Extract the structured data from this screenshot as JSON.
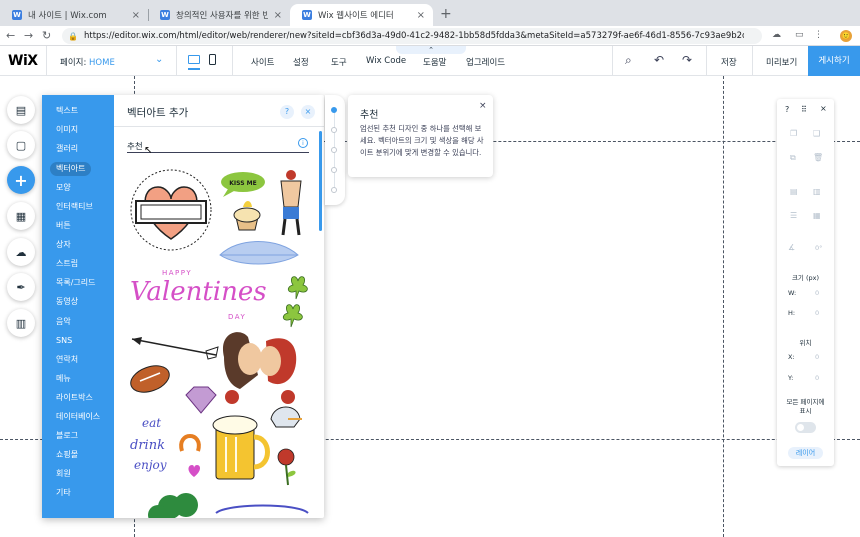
{
  "browser": {
    "tabs": [
      {
        "title": "내 사이트 | Wix.com",
        "active": false
      },
      {
        "title": "창의적인 사용자를 위한 빈 홈페이지",
        "active": false
      },
      {
        "title": "Wix 웹사이트 에디터",
        "active": true
      }
    ],
    "url": "https://editor.wix.com/html/editor/web/renderer/new?siteId=cbf36d3a-49d0-41c2-9482-1bb58d5fdda3&metaSiteId=a573279f-ae6f-46d1-8556-7c93ae9b2c84&edito...",
    "avatar": "🙂"
  },
  "topbar": {
    "logo": "WiX",
    "page_label": "페이지:",
    "page_value": "HOME",
    "menu": [
      "사이트",
      "설정",
      "도구",
      "Wix Code",
      "도움말",
      "업그레이드"
    ],
    "save": "저장",
    "preview": "미리보기",
    "publish": "게시하기",
    "collapse": "⌃"
  },
  "left_tools": [
    {
      "icon": "pages-icon",
      "glyph": "▤"
    },
    {
      "icon": "background-icon",
      "glyph": "▢"
    },
    {
      "icon": "add-icon",
      "glyph": "+"
    },
    {
      "icon": "apps-icon",
      "glyph": "▦"
    },
    {
      "icon": "upload-icon",
      "glyph": "☁"
    },
    {
      "icon": "blog-icon",
      "glyph": "✒"
    },
    {
      "icon": "bookings-icon",
      "glyph": "▥"
    }
  ],
  "panel": {
    "title": "벡터아트 추가",
    "help": "?",
    "close": "×",
    "section": "추천",
    "info": "i",
    "categories": [
      "텍스트",
      "이미지",
      "갤러리",
      "벡터아트",
      "모양",
      "인터랙티브",
      "버튼",
      "상자",
      "스트립",
      "목록/그리드",
      "동영상",
      "음악",
      "SNS",
      "연락처",
      "메뉴",
      "라이트박스",
      "데이터베이스",
      "블로그",
      "쇼핑몰",
      "회원",
      "기타"
    ],
    "selected": "벡터아트",
    "art": {
      "kiss": "KISS ME",
      "happy": "HAPPY",
      "valentines": "Valentines",
      "day": "DAY",
      "cat": "eat",
      "drink": "drink",
      "enjoy": "enjoy"
    }
  },
  "tooltip": {
    "title": "추천",
    "text": "엄선된 추천 디자인 중 하나를 선택해 보세요. 벡터아트의 크기 및 색상을 해당 사이트 분위기에 맞게 변경할 수 있습니다.",
    "close": "×"
  },
  "inspector": {
    "help": "?",
    "close": "×",
    "size_label": "크기 (px)",
    "w_label": "W:",
    "w_value": "0",
    "h_label": "H:",
    "h_value": "0",
    "pos_label": "위치",
    "x_label": "X:",
    "x_value": "0",
    "y_label": "Y:",
    "y_value": "0",
    "angle": "0°",
    "show_all": "모든 페이지에 표시",
    "layers": "레이어"
  }
}
